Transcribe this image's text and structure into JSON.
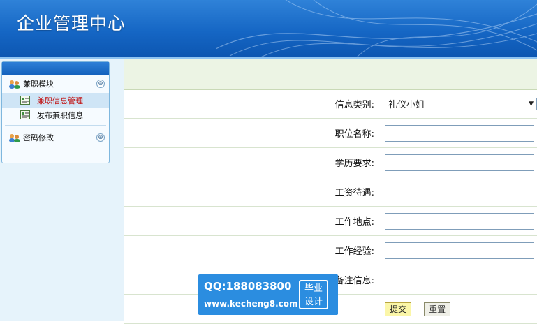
{
  "header": {
    "title": "企业管理中心"
  },
  "sidebar": {
    "sections": [
      {
        "label": "兼职模块",
        "toggle": "⊖",
        "items": [
          {
            "label": "兼职信息管理"
          },
          {
            "label": "发布兼职信息"
          }
        ]
      },
      {
        "label": "密码修改",
        "toggle": "⊕"
      }
    ]
  },
  "form": {
    "category_label": "信息类别:",
    "category_value": "礼仪小姐",
    "position_label": "职位名称:",
    "education_label": "学历要求:",
    "salary_label": "工资待遇:",
    "location_label": "工作地点:",
    "experience_label": "工作经验:",
    "remark_label": "备注信息:",
    "submit_label": "提交",
    "reset_label": "重置"
  },
  "watermark": {
    "qq": "QQ:188083800",
    "site": "www.kecheng8.com",
    "badge_line1": "毕业",
    "badge_line2": "设计"
  },
  "colors": {
    "header_blue": "#1566c4",
    "active_item_text": "#c01010",
    "watermark_blue": "#2b8de0"
  }
}
